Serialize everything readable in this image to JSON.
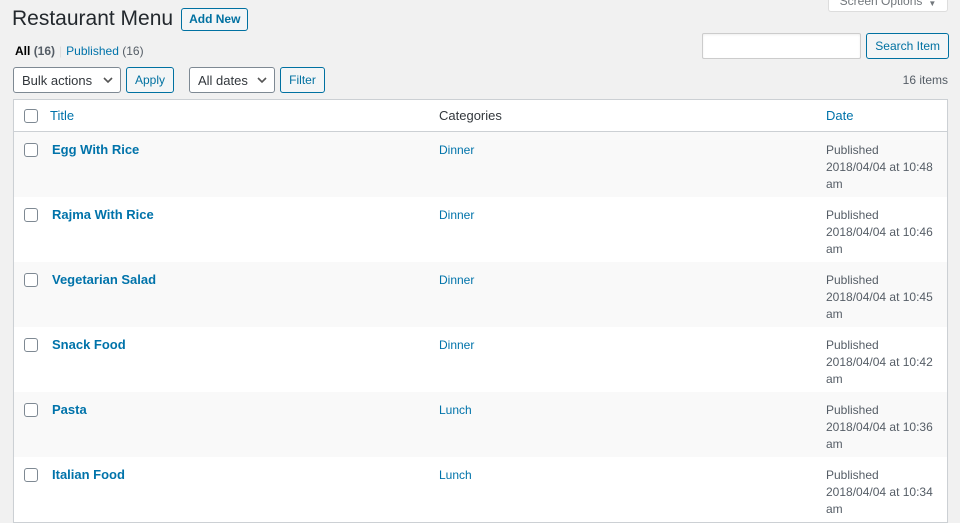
{
  "header": {
    "title": "Restaurant Menu",
    "add_new_label": "Add New",
    "screen_options_label": "Screen Options"
  },
  "views": {
    "all_label": "All",
    "all_count": "(16)",
    "separator": "|",
    "published_label": "Published",
    "published_count": "(16)"
  },
  "search": {
    "value": "",
    "button_label": "Search Item"
  },
  "tablenav": {
    "bulk_actions_selected": "Bulk actions",
    "apply_label": "Apply",
    "dates_selected": "All dates",
    "filter_label": "Filter",
    "items_count": "16 items"
  },
  "table": {
    "columns": {
      "title": "Title",
      "categories": "Categories",
      "date": "Date"
    },
    "rows": [
      {
        "title": "Egg With Rice",
        "category": "Dinner",
        "status": "Published",
        "date": "2018/04/04 at 10:48",
        "ampm": "am"
      },
      {
        "title": "Rajma With Rice",
        "category": "Dinner",
        "status": "Published",
        "date": "2018/04/04 at 10:46",
        "ampm": "am"
      },
      {
        "title": "Vegetarian Salad",
        "category": "Dinner",
        "status": "Published",
        "date": "2018/04/04 at 10:45",
        "ampm": "am"
      },
      {
        "title": "Snack Food",
        "category": "Dinner",
        "status": "Published",
        "date": "2018/04/04 at 10:42",
        "ampm": "am"
      },
      {
        "title": "Pasta",
        "category": "Lunch",
        "status": "Published",
        "date": "2018/04/04 at 10:36",
        "ampm": "am"
      },
      {
        "title": "Italian Food",
        "category": "Lunch",
        "status": "Published",
        "date": "2018/04/04 at 10:34",
        "ampm": "am"
      }
    ]
  },
  "colors": {
    "link": "#0073aa",
    "background": "#f1f1f1",
    "button_border": "#0071a1"
  }
}
